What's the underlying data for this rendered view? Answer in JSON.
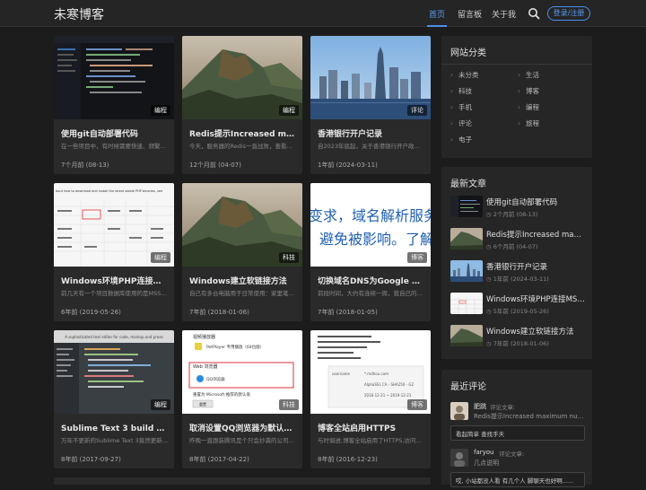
{
  "header": {
    "logo": "未寒博客",
    "nav": [
      "首页",
      "留言板",
      "关于我"
    ],
    "login": "登录/注册",
    "accent": "#4a8ff0"
  },
  "posts": [
    {
      "title": "使用git自动部署代码",
      "desc": "在一些项目中，有时候需要快速、频繁地部署代码",
      "time": "7个月前 (08-13)",
      "badge": "编程"
    },
    {
      "title": "Redis提示Increased maximum number",
      "desc": "今天，服务器的Redis一直战败，查看日志之后发现",
      "time": "12个月前 (04-07)",
      "badge": "编程"
    },
    {
      "title": "香港银行开户记录",
      "desc": "自2023年底起，关于香港银行开户政策调整之后",
      "time": "1年前 (2024-03-11)",
      "badge": "评论"
    },
    {
      "title": "Windows环境PHP连接MSSQL数据库",
      "desc": "前几天有一个项目数据库使用的是MSSQL数据库",
      "time": "6年前 (2019-05-26)",
      "badge": "编程"
    },
    {
      "title": "Windows建立软链接方法",
      "desc": "自己有多台电脑用于日常使用：家里笔记本电脑",
      "time": "7年前 (2018-01-06)",
      "badge": "科技"
    },
    {
      "title": "切换域名DNS为Google Cloud DNS",
      "desc": "前段时间，大约有连续一周，我自己的域名",
      "time": "7年前 (2018-01-05)",
      "badge": "博客"
    },
    {
      "title": "Sublime Text 3 build 3143中文输入",
      "desc": "万年不更新的Sublime Text 3竟然更新了，而且",
      "time": "8年前 (2017-09-27)",
      "badge": "编程"
    },
    {
      "title": "取消设置QQ浏览器为默认浏览器",
      "desc": "昨晚一直跟装腾讯是个只会抄袭的公司，这个",
      "time": "8年前 (2017-04-22)",
      "badge": "科技"
    },
    {
      "title": "博客全站启用HTTPS",
      "desc": "与时俱进,博客全站启用了HTTPS,访问http就会",
      "time": "8年前 (2016-12-23)",
      "badge": "博客"
    }
  ],
  "thumb_text": {
    "domain_line1": "变求，域名解析服务提",
    "domain_line2": "避免被影响。了解",
    "browser_title": "视频播放器",
    "browser_item": "PotPlayer 专用播放（64位版）",
    "browser_web": "Web 浏览器",
    "browser_qq": "QQ浏览器",
    "browser_ms": "推荐的 Microsoft 浏览器",
    "browser_reset": "重置为 Microsoft 推荐的默认值",
    "reset_label": "重置",
    "sublime_banner": "A sophisticated text editor for code, markup and prose",
    "php_intro": "bout how to download and install the latest stable PHP binaries, see",
    "https_code1": "username",
    "https_code2": "*.mdhou.com",
    "https_code3": "AlphaSSL CA - SHA256 - G2",
    "https_code4": "2016-12-21 ~ 2019-12-21"
  },
  "categories": {
    "title": "网站分类",
    "items": [
      "未分类",
      "生活",
      "科技",
      "博客",
      "手机",
      "编程",
      "评论",
      "旅程",
      "电子"
    ]
  },
  "recent_posts": {
    "title": "最新文章",
    "items": [
      {
        "title": "使用git自动部署代码",
        "time": "2个月前 (08-13)"
      },
      {
        "title": "Redis提示Increased maximum number",
        "time": "6个月前 (04-07)"
      },
      {
        "title": "香港银行开户记录",
        "time": "1年前 (2024-03-11)"
      },
      {
        "title": "Windows环境PHP连接MSSQL数据库",
        "time": "5年前 (2019-05-26)"
      },
      {
        "title": "Windows建立软链接方法",
        "time": "7年前 (2018-01-06)"
      }
    ]
  },
  "recent_comments": {
    "title": "最近评论",
    "on_label": "评论文章:",
    "items": [
      {
        "user": "肥跳",
        "post": "Redis提示Increased maximum number",
        "body": "看起简单 查找手天"
      },
      {
        "user": "faryou",
        "post": "几点说明",
        "body": "哎, 小站都没人看 有几个人 脚聊天也好啊......"
      }
    ]
  }
}
